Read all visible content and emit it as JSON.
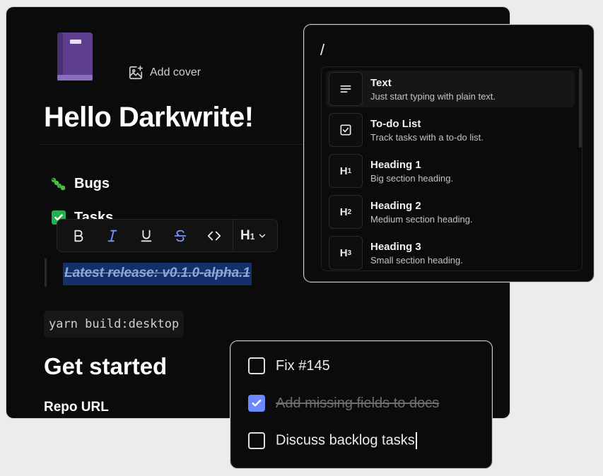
{
  "header": {
    "add_cover_label": "Add cover",
    "page_title": "Hello Darkwrite!"
  },
  "list": {
    "bugs_label": "Bugs",
    "tasks_label": "Tasks"
  },
  "toolbar": {
    "bold": "B",
    "italic": "I",
    "underline": "U",
    "strike": "S",
    "code": "<>",
    "heading": "H",
    "heading_level": "1"
  },
  "content": {
    "selected_text": "Latest release: v0.1.0-alpha.1",
    "code_block": "yarn build:desktop",
    "section_heading": "Get started",
    "field_label": "Repo URL"
  },
  "slash_menu": {
    "query": "/",
    "items": [
      {
        "title": "Text",
        "description": "Just start typing with plain text.",
        "icon": "text-lines-icon"
      },
      {
        "title": "To-do List",
        "description": "Track tasks with a to-do list.",
        "icon": "checkbox-icon"
      },
      {
        "title": "Heading 1",
        "description": "Big section heading.",
        "glyph": "H",
        "level": "1"
      },
      {
        "title": "Heading 2",
        "description": "Medium section heading.",
        "glyph": "H",
        "level": "2"
      },
      {
        "title": "Heading 3",
        "description": "Small section heading.",
        "glyph": "H",
        "level": "3"
      }
    ]
  },
  "todos": [
    {
      "text": "Fix #145",
      "checked": false
    },
    {
      "text": "Add missing fields to docs",
      "checked": true
    },
    {
      "text": "Discuss backlog tasks",
      "checked": false
    }
  ],
  "colors": {
    "accent": "#6b88ff",
    "selection": "#13306a",
    "task_green": "#22b14c"
  }
}
